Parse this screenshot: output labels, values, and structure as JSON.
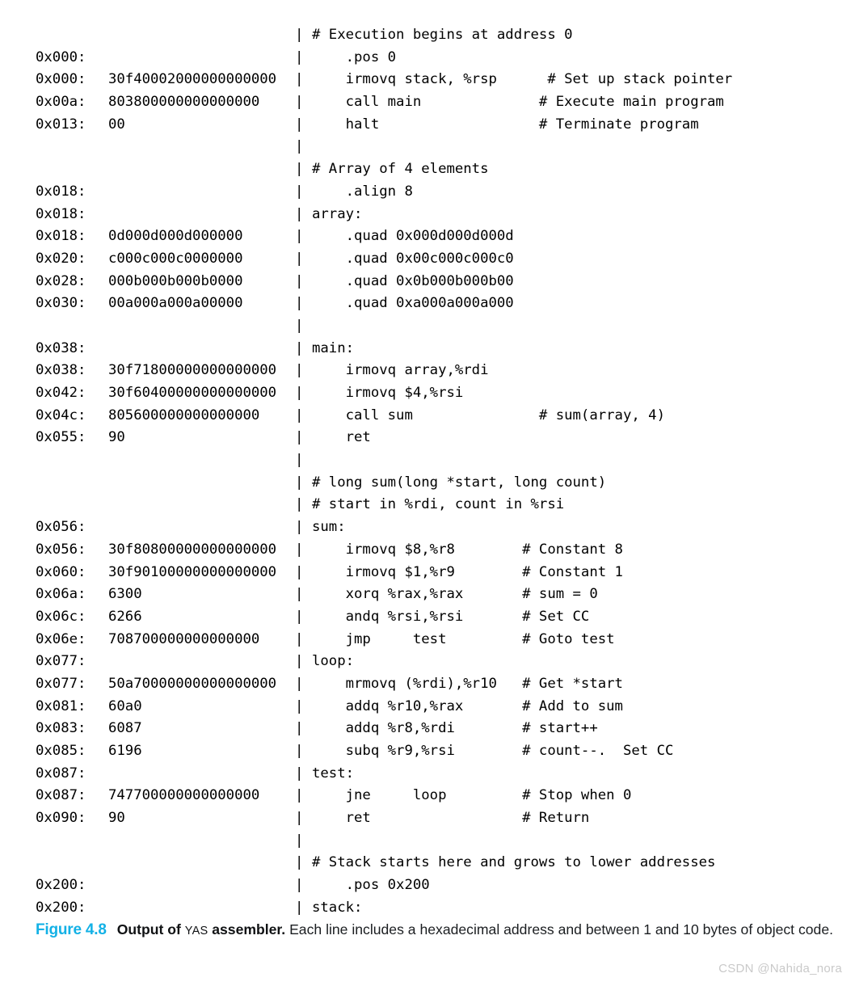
{
  "listing": {
    "lines": [
      {
        "addr": "",
        "bytes": "",
        "bar": "|",
        "src": "# Execution begins at address 0"
      },
      {
        "addr": "0x000:",
        "bytes": "",
        "bar": "|",
        "src": "    .pos 0"
      },
      {
        "addr": "0x000:",
        "bytes": "30f40002000000000000",
        "bar": "|",
        "src": "    irmovq stack, %rsp      # Set up stack pointer"
      },
      {
        "addr": "0x00a:",
        "bytes": "803800000000000000",
        "bar": "|",
        "src": "    call main              # Execute main program"
      },
      {
        "addr": "0x013:",
        "bytes": "00",
        "bar": "|",
        "src": "    halt                   # Terminate program"
      },
      {
        "addr": "",
        "bytes": "",
        "bar": "|",
        "src": ""
      },
      {
        "addr": "",
        "bytes": "",
        "bar": "|",
        "src": "# Array of 4 elements"
      },
      {
        "addr": "0x018:",
        "bytes": "",
        "bar": "|",
        "src": "    .align 8"
      },
      {
        "addr": "0x018:",
        "bytes": "",
        "bar": "|",
        "src": "array:"
      },
      {
        "addr": "0x018:",
        "bytes": "0d000d000d000000",
        "bar": "|",
        "src": "    .quad 0x000d000d000d"
      },
      {
        "addr": "0x020:",
        "bytes": "c000c000c0000000",
        "bar": "|",
        "src": "    .quad 0x00c000c000c0"
      },
      {
        "addr": "0x028:",
        "bytes": "000b000b000b0000",
        "bar": "|",
        "src": "    .quad 0x0b000b000b00"
      },
      {
        "addr": "0x030:",
        "bytes": "00a000a000a00000",
        "bar": "|",
        "src": "    .quad 0xa000a000a000"
      },
      {
        "addr": "",
        "bytes": "",
        "bar": "|",
        "src": ""
      },
      {
        "addr": "0x038:",
        "bytes": "",
        "bar": "|",
        "src": "main:"
      },
      {
        "addr": "0x038:",
        "bytes": "30f71800000000000000",
        "bar": "|",
        "src": "    irmovq array,%rdi"
      },
      {
        "addr": "0x042:",
        "bytes": "30f60400000000000000",
        "bar": "|",
        "src": "    irmovq $4,%rsi"
      },
      {
        "addr": "0x04c:",
        "bytes": "805600000000000000",
        "bar": "|",
        "src": "    call sum               # sum(array, 4)"
      },
      {
        "addr": "0x055:",
        "bytes": "90",
        "bar": "|",
        "src": "    ret"
      },
      {
        "addr": "",
        "bytes": "",
        "bar": "|",
        "src": ""
      },
      {
        "addr": "",
        "bytes": "",
        "bar": "|",
        "src": "# long sum(long *start, long count)"
      },
      {
        "addr": "",
        "bytes": "",
        "bar": "|",
        "src": "# start in %rdi, count in %rsi"
      },
      {
        "addr": "0x056:",
        "bytes": "",
        "bar": "|",
        "src": "sum:"
      },
      {
        "addr": "0x056:",
        "bytes": "30f80800000000000000",
        "bar": "|",
        "src": "    irmovq $8,%r8        # Constant 8"
      },
      {
        "addr": "0x060:",
        "bytes": "30f90100000000000000",
        "bar": "|",
        "src": "    irmovq $1,%r9        # Constant 1"
      },
      {
        "addr": "0x06a:",
        "bytes": "6300",
        "bar": "|",
        "src": "    xorq %rax,%rax       # sum = 0"
      },
      {
        "addr": "0x06c:",
        "bytes": "6266",
        "bar": "|",
        "src": "    andq %rsi,%rsi       # Set CC"
      },
      {
        "addr": "0x06e:",
        "bytes": "708700000000000000",
        "bar": "|",
        "src": "    jmp     test         # Goto test"
      },
      {
        "addr": "0x077:",
        "bytes": "",
        "bar": "|",
        "src": "loop:"
      },
      {
        "addr": "0x077:",
        "bytes": "50a70000000000000000",
        "bar": "|",
        "src": "    mrmovq (%rdi),%r10   # Get *start"
      },
      {
        "addr": "0x081:",
        "bytes": "60a0",
        "bar": "|",
        "src": "    addq %r10,%rax       # Add to sum"
      },
      {
        "addr": "0x083:",
        "bytes": "6087",
        "bar": "|",
        "src": "    addq %r8,%rdi        # start++"
      },
      {
        "addr": "0x085:",
        "bytes": "6196",
        "bar": "|",
        "src": "    subq %r9,%rsi        # count--.  Set CC"
      },
      {
        "addr": "0x087:",
        "bytes": "",
        "bar": "|",
        "src": "test:"
      },
      {
        "addr": "0x087:",
        "bytes": "747700000000000000",
        "bar": "|",
        "src": "    jne     loop         # Stop when 0"
      },
      {
        "addr": "0x090:",
        "bytes": "90",
        "bar": "|",
        "src": "    ret                  # Return"
      },
      {
        "addr": "",
        "bytes": "",
        "bar": "|",
        "src": ""
      },
      {
        "addr": "",
        "bytes": "",
        "bar": "|",
        "src": "# Stack starts here and grows to lower addresses"
      },
      {
        "addr": "0x200:",
        "bytes": "",
        "bar": "|",
        "src": "    .pos 0x200"
      },
      {
        "addr": "0x200:",
        "bytes": "",
        "bar": "|",
        "src": "stack:"
      }
    ]
  },
  "caption": {
    "figure_number": "Figure 4.8",
    "title_part1": "Output of ",
    "title_smallcaps": "YAS",
    "title_part2": " assembler.",
    "body": " Each line includes a hexadecimal address and between 1 and 10 bytes of object code.",
    "accent_color": "#13b1e6"
  },
  "watermark": {
    "text": "CSDN @Nahida_nora"
  }
}
